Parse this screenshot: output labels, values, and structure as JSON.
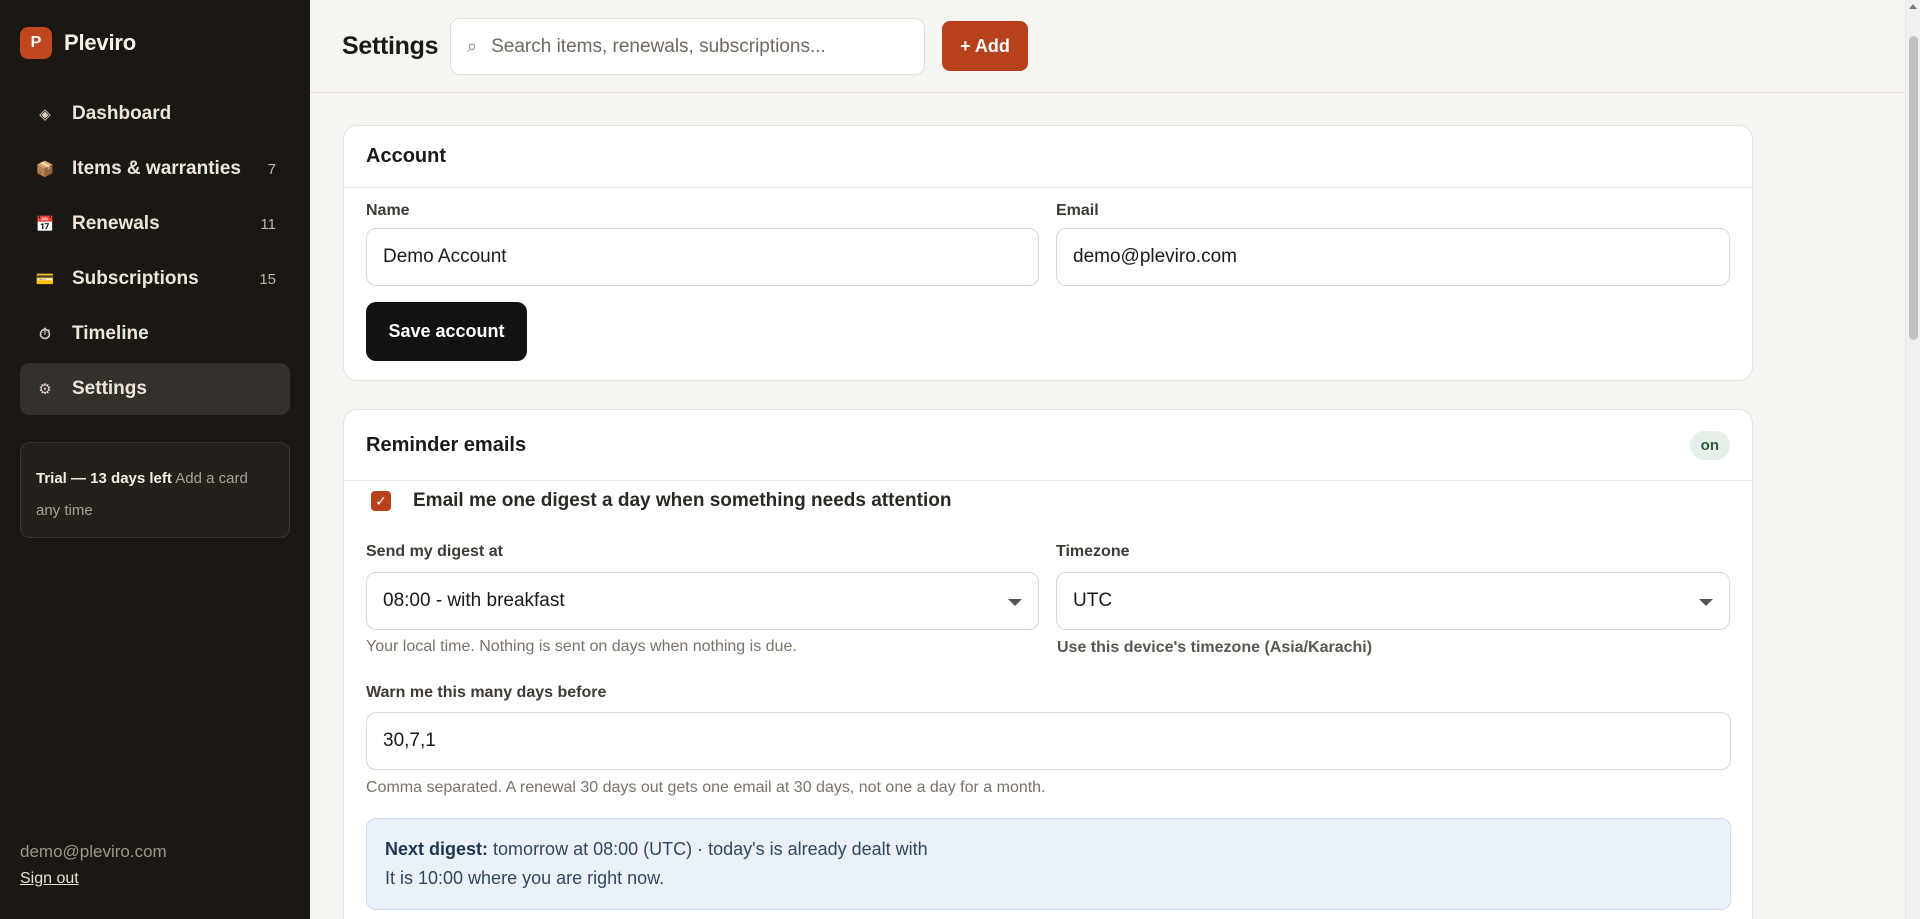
{
  "brand": {
    "logo_letter": "P",
    "name": "Pleviro"
  },
  "sidebar": {
    "items": [
      {
        "label": "Dashboard",
        "icon": "diamond-icon",
        "glyph": "◈",
        "count": ""
      },
      {
        "label": "Items & warranties",
        "icon": "box-icon",
        "glyph": "📦",
        "count": "7"
      },
      {
        "label": "Renewals",
        "icon": "calendar-icon",
        "glyph": "📅",
        "count": "11"
      },
      {
        "label": "Subscriptions",
        "icon": "credit-card-icon",
        "glyph": "💳",
        "count": "15"
      },
      {
        "label": "Timeline",
        "icon": "stopwatch-icon",
        "glyph": "⏱",
        "count": ""
      },
      {
        "label": "Settings",
        "icon": "gear-icon",
        "glyph": "⚙",
        "count": ""
      }
    ],
    "active": "Settings",
    "trial": {
      "strong": "Trial — 13 days left",
      "text": "Add a card any time"
    },
    "user_email": "demo@pleviro.com",
    "sign_out": "Sign out"
  },
  "header": {
    "title": "Settings",
    "search_placeholder": "Search items, renewals, subscriptions...",
    "add_label": "+ Add"
  },
  "account": {
    "title": "Account",
    "name_label": "Name",
    "name_value": "Demo Account",
    "email_label": "Email",
    "email_value": "demo@pleviro.com",
    "save_label": "Save account"
  },
  "reminders": {
    "title": "Reminder emails",
    "status_badge": "on",
    "digest_checkbox_label": "Email me one digest a day when something needs attention",
    "digest_checked": true,
    "send_at_label": "Send my digest at",
    "send_at_value": "08:00 - with breakfast",
    "send_at_hint": "Your local time. Nothing is sent on days when nothing is due.",
    "timezone_label": "Timezone",
    "timezone_value": "UTC",
    "timezone_hint": "Use this device's timezone (Asia/Karachi)",
    "warn_label": "Warn me this many days before",
    "warn_value": "30,7,1",
    "warn_hint": "Comma separated. A renewal 30 days out gets one email at 30 days, not one a day for a month.",
    "next_digest_label": "Next digest:",
    "next_digest_text": "tomorrow at 08:00 (UTC) · today's is already dealt with",
    "local_time_text": "It is 10:00 where you are right now."
  },
  "colors": {
    "accent": "#b6411c",
    "sidebar_bg": "#1b1814",
    "page_bg": "#f7f5f1"
  }
}
